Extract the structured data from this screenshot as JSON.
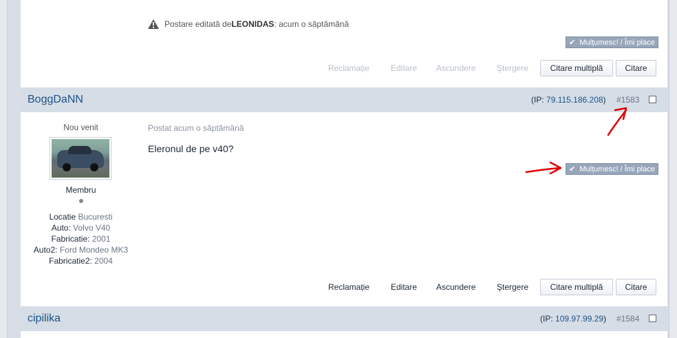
{
  "previous_post": {
    "edit_prefix": "Postare editată de ",
    "edit_author": "LEONIDAS",
    "edit_suffix": ": acum o săptămână",
    "like_label": "Mulțumesc! / Îmi place",
    "actions": {
      "report": "Reclamație",
      "edit": "Editare",
      "hide": "Ascundere",
      "delete": "Ştergere"
    },
    "multiquote_label": "Citare multiplă",
    "quote_label": "Citare"
  },
  "post": {
    "author": "BoggDaNN",
    "ip_label": "(IP: ",
    "ip_value": "79.115.186.208",
    "ip_close": ")",
    "post_number": "#1583",
    "rank_title": "Nou venit",
    "group": "Membru",
    "fields": [
      {
        "label": "Locatie",
        "value": "Bucuresti"
      },
      {
        "label": "Auto:",
        "value": "Volvo V40"
      },
      {
        "label": "Fabricatie:",
        "value": "2001"
      },
      {
        "label": "Auto2:",
        "value": "Ford Mondeo MK3"
      },
      {
        "label": "Fabricatie2:",
        "value": "2004"
      }
    ],
    "posted": "Postat acum o săptămână",
    "body": "Eleronul de pe v40?",
    "like_label": "Mulțumesc! / Îmi place",
    "actions": {
      "report": "Reclamație",
      "edit": "Editare",
      "hide": "Ascundere",
      "delete": "Ştergere"
    },
    "multiquote_label": "Citare multiplă",
    "quote_label": "Citare"
  },
  "next_post": {
    "author": "cipilika",
    "ip_label": "(IP: ",
    "ip_value": "109.97.99.29",
    "ip_close": ")",
    "post_number": "#1584"
  },
  "colors": {
    "header_bg": "#d5dde7",
    "link": "#1d5288",
    "like_button": "#98a6ba",
    "annotation": "#e00000"
  },
  "icons": [
    "warning-icon",
    "checkmark-icon",
    "red-arrow-annotation"
  ]
}
